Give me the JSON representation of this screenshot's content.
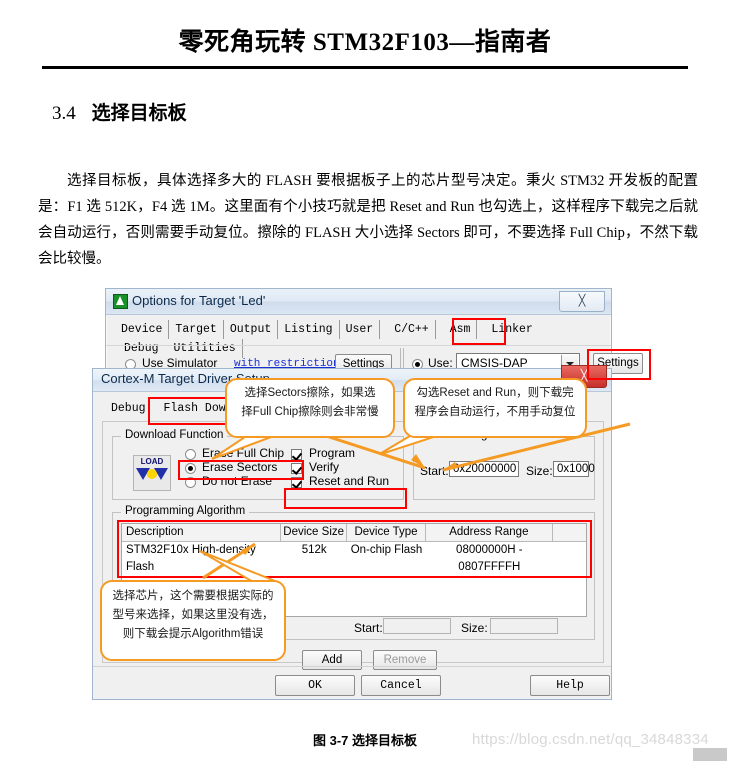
{
  "document": {
    "header_title": "零死角玩转 STM32F103—指南者",
    "section_number": "3.4",
    "section_title": "选择目标板",
    "paragraph": "选择目标板，具体选择多大的 FLASH 要根据板子上的芯片型号决定。秉火 STM32 开发板的配置是：F1 选 512K，F4 选 1M。这里面有个小技巧就是把 Reset and Run 也勾选上，这样程序下载完之后就会自动运行，否则需要手动复位。擦除的 FLASH 大小选择 Sectors 即可，不要选择 Full Chip，不然下载会比较慢。",
    "figure_caption": "图 3-7 选择目标板",
    "watermark": "https://blog.csdn.net/qq_34848334"
  },
  "options_dialog": {
    "title": "Options for Target 'Led'",
    "close_label": "╳",
    "tabs": [
      {
        "label": "Device",
        "selected": false
      },
      {
        "label": "Target",
        "selected": false
      },
      {
        "label": "Output",
        "selected": false
      },
      {
        "label": "Listing",
        "selected": false
      },
      {
        "label": "User",
        "selected": false
      },
      {
        "label": "C/C++",
        "selected": false
      },
      {
        "label": "Asm",
        "selected": false
      },
      {
        "label": "Linker",
        "selected": false
      },
      {
        "label": "Debug",
        "selected": true
      },
      {
        "label": "Utilities",
        "selected": false
      }
    ],
    "use_simulator_label": "Use Simulator",
    "with_restrictions_label": "with restrictions",
    "simulator_settings_label": "Settings",
    "use_label": "Use:",
    "debugger_value": "CMSIS-DAP Debugger",
    "use_settings_label": "Settings",
    "use_simulator_selected": false,
    "use_selected": true
  },
  "cortex_dialog": {
    "title": "Cortex-M Target Driver Setup",
    "close_label": "╳",
    "tabs": [
      {
        "label": "Debug",
        "selected": false
      },
      {
        "label": "Flash Download",
        "selected": true
      }
    ],
    "download_function": {
      "group_title": "Download Function",
      "icon_label": "LOAD",
      "radios": [
        {
          "label": "Erase Full Chip",
          "checked": false
        },
        {
          "label": "Erase Sectors",
          "checked": true
        },
        {
          "label": "Do not Erase",
          "checked": false
        }
      ],
      "checkboxes": [
        {
          "label": "Program",
          "checked": true
        },
        {
          "label": "Verify",
          "checked": true
        },
        {
          "label": "Reset and Run",
          "checked": true
        }
      ]
    },
    "ram_for_algorithm": {
      "group_title": "RAM for Algorithm",
      "start_label": "Start:",
      "start_value": "0x20000000",
      "size_label": "Size:",
      "size_value": "0x1000"
    },
    "programming_algorithm": {
      "group_title": "Programming Algorithm",
      "columns": [
        "Description",
        "Device Size",
        "Device Type",
        "Address Range",
        ""
      ],
      "rows": [
        [
          "STM32F10x High-density Flash",
          "512k",
          "On-chip Flash",
          "08000000H - 0807FFFFH",
          ""
        ]
      ],
      "start_label": "Start:",
      "start_value": "",
      "size_label": "Size:",
      "size_value": "",
      "add_label": "Add",
      "remove_label": "Remove"
    },
    "buttons": {
      "ok": "OK",
      "cancel": "Cancel",
      "help": "Help"
    }
  },
  "callouts": [
    {
      "id": "sectors-note",
      "lines": [
        "选择Sectors擦除，如果选",
        "择Full Chip擦除则会非常慢"
      ]
    },
    {
      "id": "reset-run-note",
      "lines": [
        "勾选Reset and Run，则下载完",
        "程序会自动运行，不用手动复位"
      ]
    },
    {
      "id": "chip-note",
      "lines": [
        "选择芯片，这个需要根据实际的",
        "型号来选择，如果这里没有选，",
        "则下载会提示Algorithm错误"
      ]
    }
  ],
  "colors": {
    "highlight_red": "#ff0000",
    "callout_orange": "#f59a23",
    "titlebar_blue": "#0b2a4a",
    "link_blue": "#1a2fd0"
  }
}
